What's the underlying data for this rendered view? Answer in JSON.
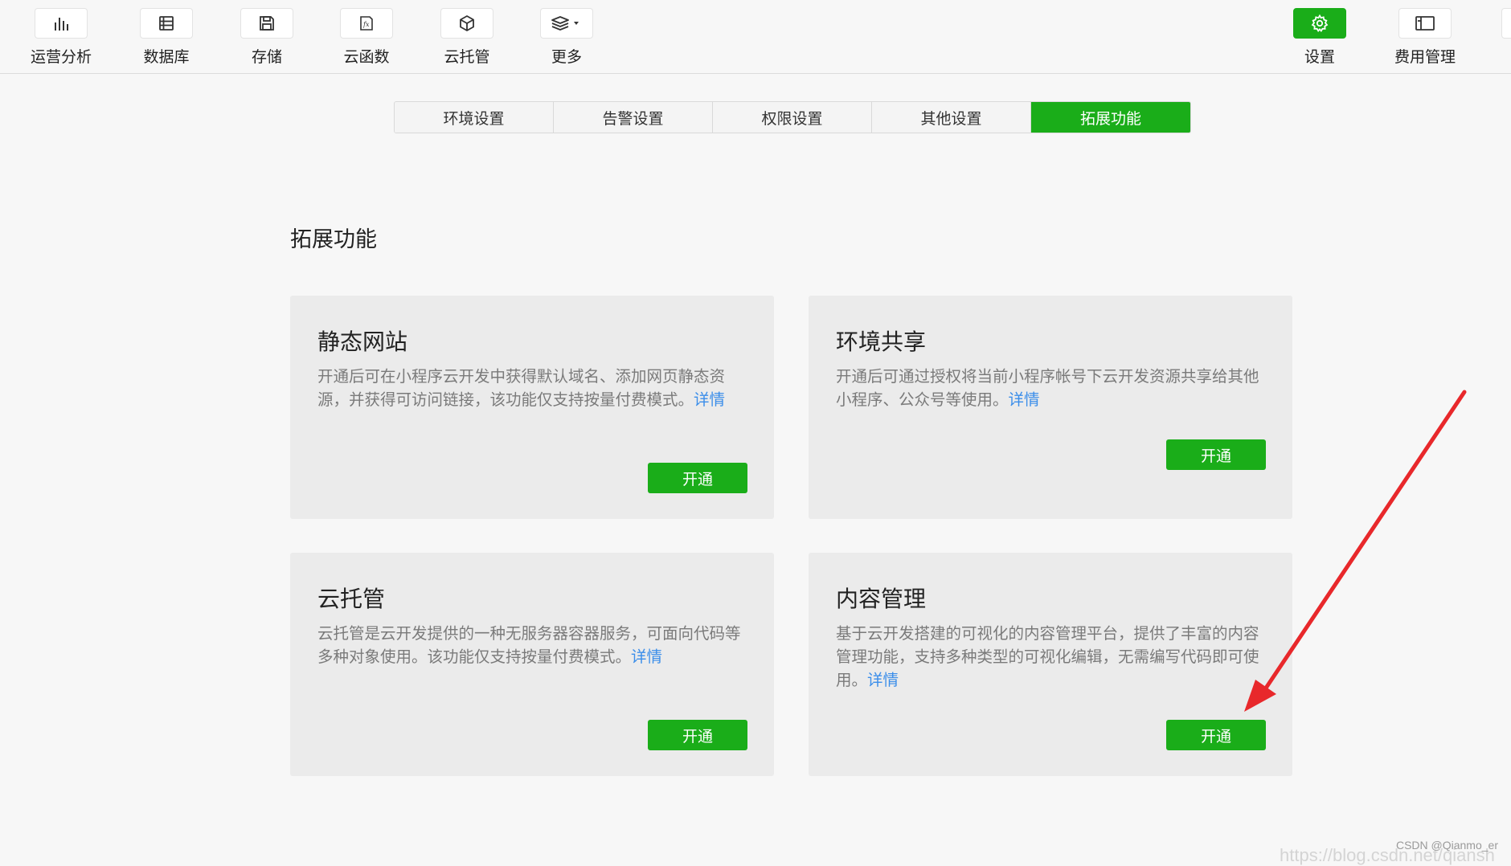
{
  "toolbar": {
    "items": [
      {
        "label": "运营分析",
        "icon": "bar-chart-icon"
      },
      {
        "label": "数据库",
        "icon": "database-icon"
      },
      {
        "label": "存储",
        "icon": "save-icon"
      },
      {
        "label": "云函数",
        "icon": "function-icon"
      },
      {
        "label": "云托管",
        "icon": "cube-icon"
      },
      {
        "label": "更多",
        "icon": "layers-icon"
      }
    ],
    "right_items": [
      {
        "label": "设置",
        "icon": "gear-icon",
        "active": true
      },
      {
        "label": "费用管理",
        "icon": "billing-icon"
      }
    ]
  },
  "tabs": [
    {
      "label": "环境设置"
    },
    {
      "label": "告警设置"
    },
    {
      "label": "权限设置"
    },
    {
      "label": "其他设置"
    },
    {
      "label": "拓展功能",
      "active": true
    }
  ],
  "section": {
    "title": "拓展功能"
  },
  "cards": [
    {
      "title": "静态网站",
      "desc": "开通后可在小程序云开发中获得默认域名、添加网页静态资源，并获得可访问链接，该功能仅支持按量付费模式。",
      "link": "详情",
      "button": "开通"
    },
    {
      "title": "环境共享",
      "desc": "开通后可通过授权将当前小程序帐号下云开发资源共享给其他小程序、公众号等使用。",
      "link": "详情",
      "button": "开通"
    },
    {
      "title": "云托管",
      "desc": "云托管是云开发提供的一种无服务器容器服务，可面向代码等多种对象使用。该功能仅支持按量付费模式。",
      "link": "详情",
      "button": "开通"
    },
    {
      "title": "内容管理",
      "desc": "基于云开发搭建的可视化的内容管理平台，提供了丰富的内容管理功能，支持多种类型的可视化编辑，无需编写代码即可使用。",
      "link": "详情",
      "button": "开通"
    }
  ],
  "colors": {
    "accent": "#1aad19",
    "link": "#3b8eea",
    "annotation": "#e8282b"
  },
  "watermark": "CSDN @Qianmo_er",
  "watermark_url": "https://blog.csdn.net/qiansh"
}
